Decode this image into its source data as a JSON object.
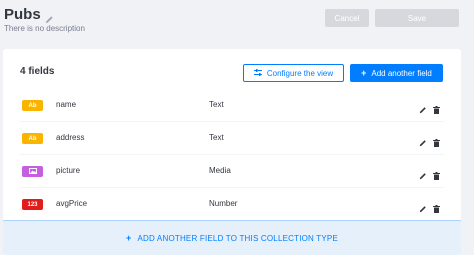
{
  "header": {
    "title": "Pubs",
    "description": "There is no description",
    "cancel_label": "Cancel",
    "save_label": "Save"
  },
  "content": {
    "fields_count": "4 fields",
    "configure_label": "Configure the view",
    "add_field_label": "Add another field",
    "fields": [
      {
        "badge": "Ab",
        "badge_color": "#fab400",
        "name": "name",
        "type": "Text"
      },
      {
        "badge": "Ab",
        "badge_color": "#fab400",
        "name": "address",
        "type": "Text"
      },
      {
        "badge": "",
        "badge_icon": "image-icon",
        "badge_color": "#c75ee0",
        "name": "picture",
        "type": "Media"
      },
      {
        "badge": "123",
        "badge_color": "#e21b1b",
        "name": "avgPrice",
        "type": "Number"
      }
    ],
    "footer_add_label": "ADD ANOTHER FIELD TO THIS COLLECTION TYPE"
  },
  "colors": {
    "primary": "#007eff",
    "disabled_button": "#d6d8dd",
    "footer_bg": "#e6f0fb"
  }
}
